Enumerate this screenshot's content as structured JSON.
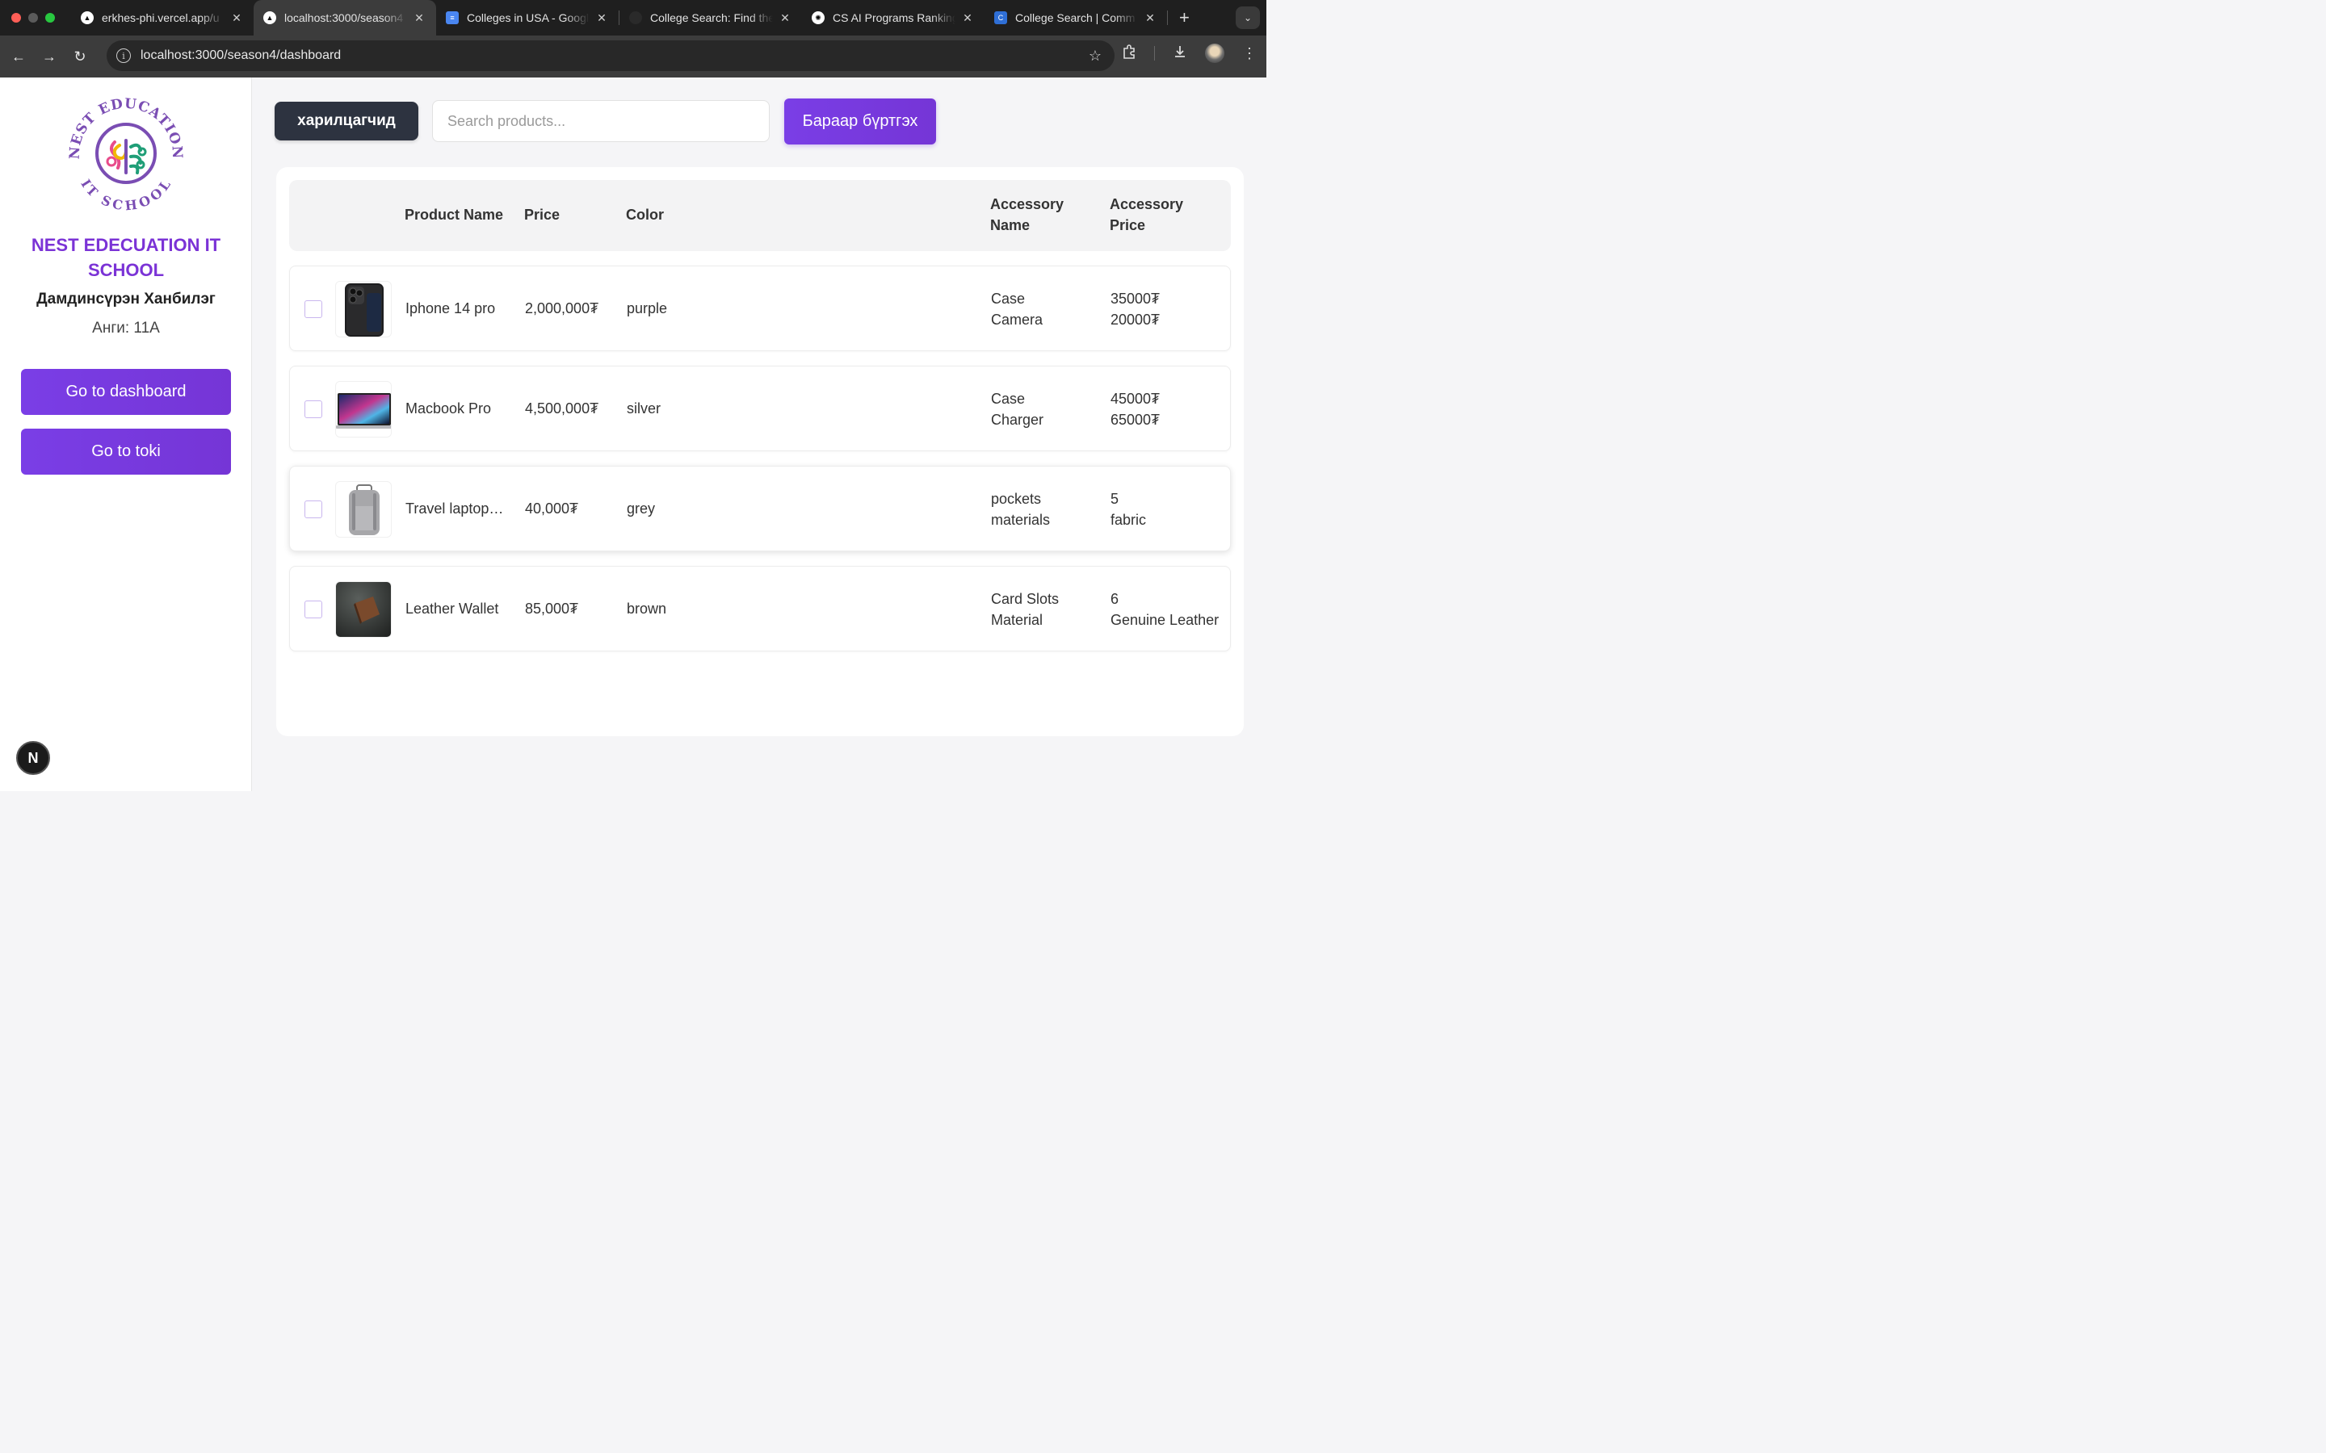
{
  "browser": {
    "tabs": [
      {
        "title": "erkhes-phi.vercel.app/u",
        "favicon": "vercel-icon",
        "active": false
      },
      {
        "title": "localhost:3000/season4",
        "favicon": "vercel-icon",
        "active": true
      },
      {
        "title": "Colleges in USA - Googl",
        "favicon": "google-docs-icon",
        "active": false
      },
      {
        "title": "College Search: Find the",
        "favicon": "college-search-icon",
        "active": false
      },
      {
        "title": "CS AI Programs Ranking",
        "favicon": "openai-icon",
        "active": false
      },
      {
        "title": "College Search | Comm",
        "favicon": "common-app-icon",
        "active": false
      }
    ],
    "url": "localhost:3000/season4/dashboard"
  },
  "sidebar": {
    "logo_text_top": "NEST EDUCATION",
    "logo_text_bottom": "IT SCHOOL",
    "school_name": "NEST EDECUATION IT SCHOOL",
    "student_name": "Дамдинсүрэн Ханбилэг",
    "student_class": "Анги: 11А",
    "buttons": [
      {
        "label": "Go to dashboard"
      },
      {
        "label": "Go to toki"
      }
    ],
    "framework_badge": "N"
  },
  "toolbar": {
    "customers_label": "харилцагчид",
    "search_placeholder": "Search products...",
    "search_value": "",
    "register_label": "Бараар бүртгэх"
  },
  "table": {
    "headers": {
      "product_name": "Product Name",
      "price": "Price",
      "color": "Color",
      "accessory_name_1": "Accessory",
      "accessory_name_2": "Name",
      "accessory_price_1": "Accessory",
      "accessory_price_2": "Price"
    },
    "rows": [
      {
        "name": "Iphone 14 pro",
        "price": "2,000,000₮",
        "color": "purple",
        "image": "iphone-image",
        "acc_names": [
          "Case",
          "Camera"
        ],
        "acc_prices": [
          "35000₮",
          "20000₮"
        ]
      },
      {
        "name": "Macbook Pro",
        "price": "4,500,000₮",
        "color": "silver",
        "image": "macbook-image",
        "acc_names": [
          "Case",
          "Charger"
        ],
        "acc_prices": [
          "45000₮",
          "65000₮"
        ]
      },
      {
        "name": "Travel laptop backpack",
        "price": "40,000₮",
        "color": "grey",
        "image": "backpack-image",
        "acc_names": [
          "pockets",
          "materials"
        ],
        "acc_prices": [
          "5",
          "fabric"
        ]
      },
      {
        "name": "Leather Wallet",
        "price": "85,000₮",
        "color": "brown",
        "image": "wallet-image",
        "acc_names": [
          "Card Slots",
          "Material"
        ],
        "acc_prices": [
          "6",
          "Genuine Leather"
        ]
      }
    ]
  },
  "colors": {
    "accent": "#7a3ee6",
    "dark_button": "#2d3340",
    "school_name": "#7b33d6"
  }
}
